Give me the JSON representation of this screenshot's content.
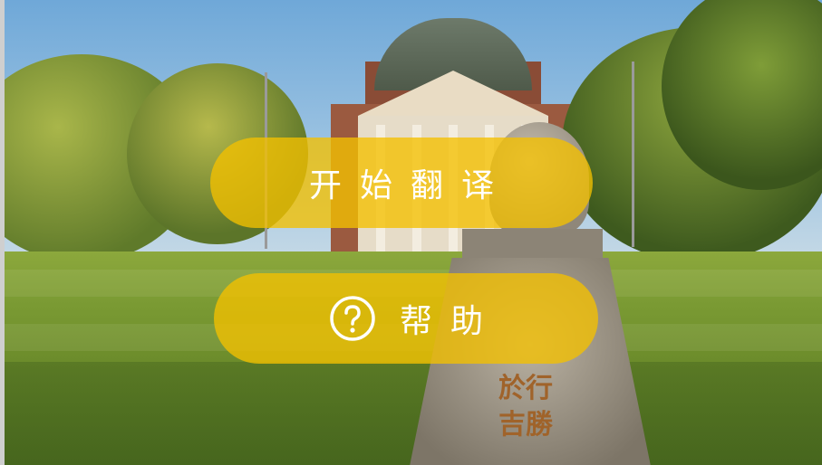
{
  "buttons": {
    "start_translate_label": "开始翻译",
    "help_label": "帮助"
  },
  "icons": {
    "help": "question-circle-icon"
  },
  "background": {
    "stone_inscription": [
      "於行",
      "吉勝"
    ]
  },
  "colors": {
    "button_fill": "#F4C000",
    "button_text": "#FFFFFF"
  }
}
